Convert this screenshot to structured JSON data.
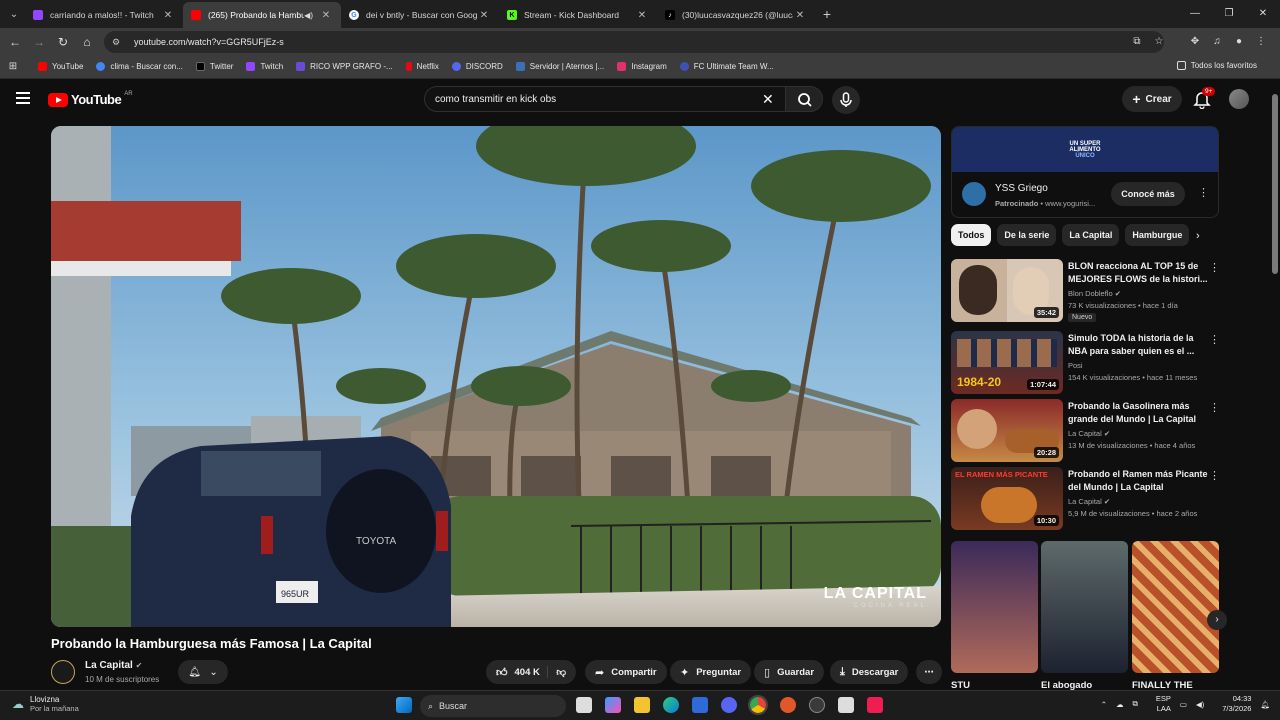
{
  "browser": {
    "tabs": [
      {
        "title": "carriando a malos!! - Twitch",
        "color": "#9146ff"
      },
      {
        "title": "(265) Probando la Hamburg",
        "color": "#ff0000",
        "active": true
      },
      {
        "title": "dei v bntly - Buscar con Google",
        "color": "#4285f4"
      },
      {
        "title": "Stream - Kick Dashboard",
        "color": "#53fc18"
      },
      {
        "title": "(30)luucasvazquez26 (@luucas",
        "color": "#000000"
      }
    ],
    "url": "youtube.com/watch?v=GGR5UFjEz-s",
    "bookmarks": [
      {
        "label": "YouTube",
        "color": "#ff0000"
      },
      {
        "label": "clima - Buscar con...",
        "color": "#4285f4"
      },
      {
        "label": "Twitter",
        "color": "#000000"
      },
      {
        "label": "Twitch",
        "color": "#9146ff"
      },
      {
        "label": "RICO WPP GRAFO -...",
        "color": "#6b4bd6"
      },
      {
        "label": "Netflix",
        "color": "#e50914"
      },
      {
        "label": "DISCORD",
        "color": "#5865f2"
      },
      {
        "label": "Servidor | Aternos |...",
        "color": "#3b6fb6"
      },
      {
        "label": "Instagram",
        "color": "#e1306c"
      },
      {
        "label": "FC Ultimate Team W...",
        "color": "#3f51b5"
      }
    ],
    "all_bookmarks": "Todos los favoritos"
  },
  "youtube": {
    "logo": "YouTube",
    "country": "AR",
    "search_value": "como transmitir en kick obs",
    "create_label": "Crear",
    "notif_count": "9+",
    "video": {
      "title": "Probando la Hamburguesa más Famosa | La Capital",
      "watermark": "LA CAPITAL",
      "watermark_sub": "COCINA REAL",
      "channel": "La Capital",
      "subs": "10 M de suscriptores",
      "likes": "404 K",
      "share": "Compartir",
      "ask": "Preguntar",
      "save": "Guardar",
      "download": "Descargar"
    },
    "ad": {
      "banner_line1": "UN SUPER",
      "banner_line2": "ALIMENTO",
      "banner_line3": "ÚNICO",
      "name": "YSS Griego",
      "sponsored": "Patrocinado",
      "domain": "www.yogurisi...",
      "cta": "Conocé más"
    },
    "chips": [
      "Todos",
      "De la serie",
      "La Capital",
      "Hamburgue"
    ],
    "recommendations": [
      {
        "title": "BLON reacciona AL TOP 15 de MEJORES FLOWS de la histori...",
        "channel": "Blon Dobleflo",
        "meta": "73 K visualizaciones • hace 1 día",
        "duration": "35:42",
        "badge": "Nuevo"
      },
      {
        "title": "Simulo TODA la historia de la NBA para saber quien es el ...",
        "channel": "Posi",
        "meta": "154 K visualizaciones • hace 11 meses",
        "duration": "1:07:44",
        "badge": ""
      },
      {
        "title": "Probando la Gasolinera más grande del Mundo | La Capital",
        "channel": "La Capital",
        "meta": "13 M de visualizaciones • hace 4 años",
        "duration": "20:28",
        "badge": ""
      },
      {
        "title": "Probando el Ramen más Picante del Mundo | La Capital",
        "channel": "La Capital",
        "meta": "5,9 M de visualizaciones • hace 2 años",
        "duration": "10:30",
        "badge": ""
      }
    ],
    "thumb_texts": [
      "1984-20",
      "EL RAMEN MÁS PICANTE"
    ],
    "shorts": [
      "STU",
      "El abogado",
      "FINALLY THE"
    ]
  },
  "taskbar": {
    "weather_place": "Llovizna",
    "weather_time": "Por la mañana",
    "search": "Buscar",
    "lang1": "ESP",
    "lang2": "LAA",
    "time": "04:33",
    "date": "7/3/2026"
  }
}
